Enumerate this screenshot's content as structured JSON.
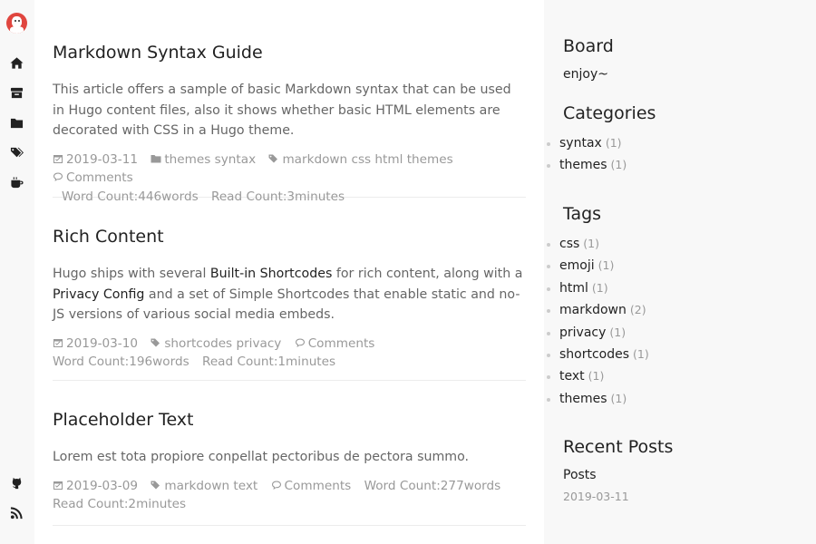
{
  "rail": {
    "avatar": "avatar",
    "top_icons": [
      "home-icon",
      "archive-icon",
      "folder-icon",
      "tags-icon",
      "coffee-icon"
    ],
    "bottom_icons": [
      "github-icon",
      "rss-icon"
    ]
  },
  "posts": [
    {
      "title": "Markdown Syntax Guide",
      "summary": "This article offers a sample of basic Markdown syntax that can be used in Hugo content files, also it shows whether basic HTML elements are decorated with CSS in a Hugo theme.",
      "date": "2019-03-11",
      "categories": "themes syntax",
      "tags": "markdown css html themes",
      "comments": "Comments",
      "word_count": "Word Count:446words",
      "read_count": "Read Count:3minutes"
    },
    {
      "title": "Rich Content",
      "summary_parts": {
        "p1": "Hugo ships with several ",
        "link1": "Built-in Shortcodes",
        "p2": " for rich content, along with a ",
        "link2": "Privacy Config",
        "p3": " and a set of Simple Shortcodes that enable static and no-JS versions of various social media embeds."
      },
      "date": "2019-03-10",
      "tags": "shortcodes privacy",
      "comments": "Comments",
      "word_count": "Word Count:196words",
      "read_count": "Read Count:1minutes"
    },
    {
      "title": "Placeholder Text",
      "summary": "Lorem est tota propiore conpellat pectoribus de pectora summo.",
      "date": "2019-03-09",
      "tags": "markdown text",
      "comments": "Comments",
      "word_count": "Word Count:277words",
      "read_count": "Read Count:2minutes"
    }
  ],
  "sidebar": {
    "board_title": "Board",
    "board_text": "enjoy~",
    "categories_title": "Categories",
    "categories": [
      {
        "name": "syntax",
        "count": "(1)"
      },
      {
        "name": "themes",
        "count": "(1)"
      }
    ],
    "tags_title": "Tags",
    "tags": [
      {
        "name": "css",
        "count": "(1)"
      },
      {
        "name": "emoji",
        "count": "(1)"
      },
      {
        "name": "html",
        "count": "(1)"
      },
      {
        "name": "markdown",
        "count": "(2)"
      },
      {
        "name": "privacy",
        "count": "(1)"
      },
      {
        "name": "shortcodes",
        "count": "(1)"
      },
      {
        "name": "text",
        "count": "(1)"
      },
      {
        "name": "themes",
        "count": "(1)"
      }
    ],
    "recent_title": "Recent Posts",
    "recent_posts": [
      {
        "title": "Posts",
        "date": "2019-03-11"
      }
    ]
  },
  "colors": {
    "rail_bg": "#f8f8f8",
    "sidebar_bg": "#f8f8f8",
    "meta_gray": "#999999",
    "avatar_red": "#e0463f"
  }
}
